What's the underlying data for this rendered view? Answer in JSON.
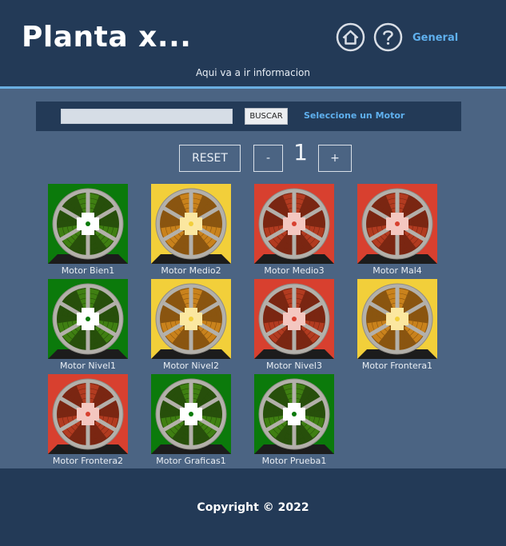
{
  "header": {
    "title": "Planta x...",
    "subtitle": "Aqui va a ir informacion",
    "general_link": "General",
    "home_icon": "home-icon",
    "help_icon": "help-icon"
  },
  "search": {
    "value": "",
    "placeholder": "",
    "button_label": "BUSCAR",
    "hint": "Seleccione un Motor"
  },
  "pagination": {
    "reset_label": "RESET",
    "minus_label": "-",
    "page": "1",
    "plus_label": "+"
  },
  "colors": {
    "green": "#0b7a0b",
    "yellow": "#f2cf3a",
    "red": "#d8402f",
    "accent": "#5fb0ee",
    "header_bg": "#233a57",
    "body_bg": "#4b6483"
  },
  "motors": [
    {
      "label": "Motor Bien1",
      "status": "green",
      "icon": "motor-icon"
    },
    {
      "label": "Motor Medio2",
      "status": "yellow",
      "icon": "motor-icon"
    },
    {
      "label": "Motor Medio3",
      "status": "red",
      "icon": "motor-icon"
    },
    {
      "label": "Motor Mal4",
      "status": "red",
      "icon": "motor-icon"
    },
    {
      "label": "Motor Nivel1",
      "status": "green",
      "icon": "motor-icon"
    },
    {
      "label": "Motor Nivel2",
      "status": "yellow",
      "icon": "motor-icon"
    },
    {
      "label": "Motor Nivel3",
      "status": "red",
      "icon": "motor-icon"
    },
    {
      "label": "Motor Frontera1",
      "status": "yellow",
      "icon": "motor-icon"
    },
    {
      "label": "Motor Frontera2",
      "status": "red",
      "icon": "motor-icon"
    },
    {
      "label": "Motor Graficas1",
      "status": "green",
      "icon": "motor-icon"
    },
    {
      "label": "Motor Prueba1",
      "status": "green",
      "icon": "motor-icon"
    }
  ],
  "footer": {
    "copyright": "Copyright © 2022"
  }
}
